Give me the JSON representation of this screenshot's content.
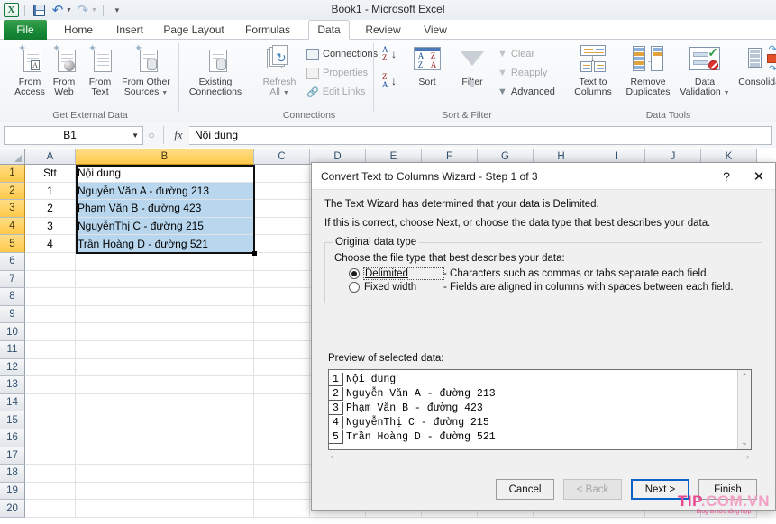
{
  "window": {
    "title": "Book1  -  Microsoft Excel",
    "app_logo": "X"
  },
  "quick_access": {
    "items": [
      {
        "name": "save-icon",
        "label": "Save"
      },
      {
        "name": "undo-icon",
        "label": "Undo",
        "glyph": "↶"
      },
      {
        "name": "redo-icon",
        "label": "Redo",
        "glyph": "↷"
      },
      {
        "name": "customize-qat-icon",
        "label": "Customize Quick Access Toolbar",
        "glyph": "─"
      }
    ]
  },
  "ribbon": {
    "tabs": [
      {
        "label": "File",
        "active": false
      },
      {
        "label": "Home",
        "active": false
      },
      {
        "label": "Insert",
        "active": false
      },
      {
        "label": "Page Layout",
        "active": false
      },
      {
        "label": "Formulas",
        "active": false
      },
      {
        "label": "Data",
        "active": true
      },
      {
        "label": "Review",
        "active": false
      },
      {
        "label": "View",
        "active": false
      }
    ],
    "groups": [
      {
        "label": "Get External Data",
        "buttons": [
          {
            "label_line1": "From",
            "label_line2": "Access",
            "icon": "from-access-icon"
          },
          {
            "label_line1": "From",
            "label_line2": "Web",
            "icon": "from-web-icon"
          },
          {
            "label_line1": "From",
            "label_line2": "Text",
            "icon": "from-text-icon"
          },
          {
            "label_line1": "From Other",
            "label_line2": "Sources",
            "icon": "from-other-sources-icon"
          }
        ]
      },
      {
        "label": "Connections",
        "buttons": [
          {
            "label_line1": "Existing",
            "label_line2": "Connections",
            "icon": "existing-connections-icon"
          },
          {
            "label_line1": "Refresh",
            "label_line2": "All",
            "icon": "refresh-all-icon"
          }
        ],
        "small_buttons": [
          {
            "label": "Connections",
            "icon": "connections-icon",
            "disabled": false
          },
          {
            "label": "Properties",
            "icon": "properties-icon",
            "disabled": true
          },
          {
            "label": "Edit Links",
            "icon": "edit-links-icon",
            "disabled": true
          }
        ]
      },
      {
        "label": "Sort & Filter",
        "buttons": [
          {
            "label_line1": "Sort",
            "label_line2": "",
            "icon": "sort-dialog-icon"
          },
          {
            "label_line1": "Filter",
            "label_line2": "",
            "icon": "filter-icon"
          }
        ],
        "small_buttons": [
          {
            "label": "Clear",
            "icon": "clear-filter-icon",
            "disabled": true
          },
          {
            "label": "Reapply",
            "icon": "reapply-filter-icon",
            "disabled": true
          },
          {
            "label": "Advanced",
            "icon": "advanced-filter-icon",
            "disabled": false
          }
        ],
        "sort_asc": "sort-ascending-icon",
        "sort_desc": "sort-descending-icon"
      },
      {
        "label": "Data Tools",
        "buttons": [
          {
            "label_line1": "Text to",
            "label_line2": "Columns",
            "icon": "text-to-columns-icon"
          },
          {
            "label_line1": "Remove",
            "label_line2": "Duplicates",
            "icon": "remove-duplicates-icon"
          },
          {
            "label_line1": "Data",
            "label_line2": "Validation",
            "icon": "data-validation-icon"
          },
          {
            "label_line1": "Consolidate",
            "label_line2": "",
            "icon": "consolidate-icon"
          }
        ]
      }
    ]
  },
  "formula_bar": {
    "name_box": "B1",
    "fx_label": "fx",
    "value": "Nội dung"
  },
  "grid": {
    "columns": [
      "A",
      "B",
      "C",
      "D",
      "E",
      "F",
      "G",
      "H",
      "I",
      "J",
      "K"
    ],
    "selected_column": "B",
    "rows": [
      "1",
      "2",
      "3",
      "4",
      "5",
      "6",
      "7",
      "8",
      "9",
      "10",
      "11",
      "12",
      "13",
      "14",
      "15",
      "16",
      "17",
      "18",
      "19",
      "20"
    ],
    "selected_rows": [
      "1",
      "2",
      "3",
      "4",
      "5"
    ],
    "data": [
      {
        "row": "1",
        "A": "Stt",
        "B": "Nội dung",
        "shaded": false
      },
      {
        "row": "2",
        "A": "1",
        "B": "Nguyễn Văn A - đường 213",
        "shaded": true
      },
      {
        "row": "3",
        "A": "2",
        "B": "Phạm Văn B - đường 423",
        "shaded": true
      },
      {
        "row": "4",
        "A": "3",
        "B": "NguyễnThị C - đường 215",
        "shaded": true
      },
      {
        "row": "5",
        "A": "4",
        "B": "Trần Hoàng D - đường 521",
        "shaded": true
      }
    ]
  },
  "dialog": {
    "title": "Convert Text to Columns Wizard - Step 1 of 3",
    "help_icon": "?",
    "close_icon": "✕",
    "line1": "The Text Wizard has determined that your data is Delimited.",
    "line2": "If this is correct, choose Next, or choose the data type that best describes your data.",
    "group_legend": "Original data type",
    "group_prompt": "Choose the file type that best describes your data:",
    "options": [
      {
        "label": "Delimited",
        "accel": "D",
        "description": "- Characters such as commas or tabs separate each field.",
        "selected": true
      },
      {
        "label": "Fixed width",
        "accel": "w",
        "description": "- Fields are aligned in columns with spaces between each field.",
        "selected": false
      }
    ],
    "preview_label": "Preview of selected data:",
    "preview_rows": [
      {
        "num": "1",
        "text": "Nội dung"
      },
      {
        "num": "2",
        "text": "Nguyễn Văn A - đường 213"
      },
      {
        "num": "3",
        "text": "Phạm Văn B - đường 423"
      },
      {
        "num": "4",
        "text": "NguyễnThị C - đường 215"
      },
      {
        "num": "5",
        "text": "Trần Hoàng D - đường 521"
      }
    ],
    "scroll": {
      "up": "⌃",
      "down": "⌄",
      "left": "‹",
      "right": "›"
    },
    "buttons": [
      {
        "label": "Cancel",
        "state": "normal",
        "name": "cancel-button"
      },
      {
        "label": "< Back",
        "state": "disabled",
        "name": "back-button"
      },
      {
        "label": "Next >",
        "state": "default",
        "name": "next-button"
      },
      {
        "label": "Finish",
        "state": "normal",
        "name": "finish-button"
      }
    ]
  },
  "watermark": {
    "part1": "TIP",
    "part2": ".COM.VN",
    "tagline": "Blog tin tức tổng hợp"
  },
  "colors": {
    "accent_green": "#198a38",
    "selection_orange": "#ffc94a",
    "cell_shade_blue": "#b8d7ee",
    "dialog_default_blue": "#0a64c8",
    "watermark_pink": "#e8488f"
  }
}
